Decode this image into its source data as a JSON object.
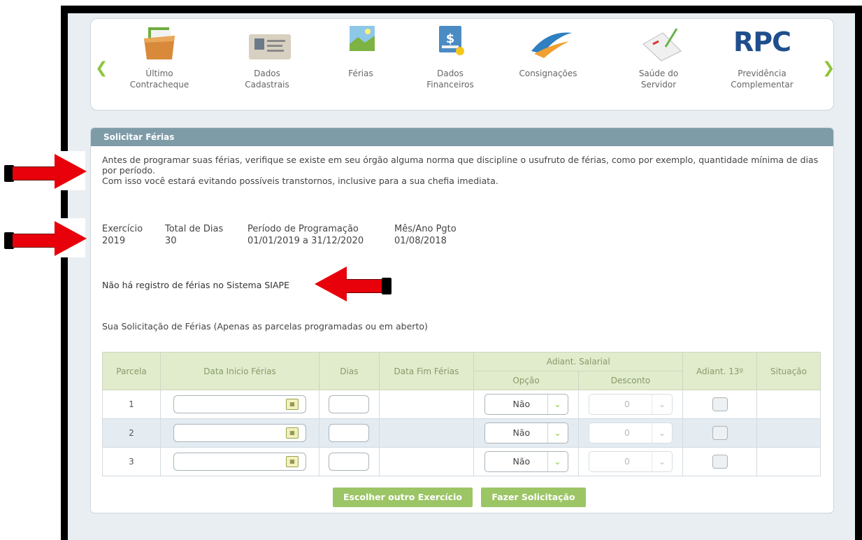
{
  "carousel": {
    "items": [
      {
        "label": "Último\nContracheque",
        "icon": "folder-icon"
      },
      {
        "label": "Dados\nCadastrais",
        "icon": "id-card-icon"
      },
      {
        "label": "Férias",
        "icon": "landscape-icon"
      },
      {
        "label": "Dados\nFinanceiros",
        "icon": "money-icon"
      },
      {
        "label": "Consignações",
        "icon": "swoosh-icon"
      },
      {
        "label": "Saúde do\nServidor",
        "icon": "clipboard-pen-icon"
      },
      {
        "label": "Previdência\nComplementar",
        "icon": "rpc-logo-icon",
        "logo_text": "RPC"
      }
    ],
    "prev_glyph": "❮",
    "next_glyph": "❯"
  },
  "panel": {
    "title": "Solicitar Férias",
    "intro_line1": "Antes de programar suas férias, verifique se existe em seu órgão alguma norma que discipline o usufruto de férias, como por exemplo, quantidade mínima de dias por período.",
    "intro_line2": "Com isso você estará evitando possíveis transtornos, inclusive para a sua chefia imediata.",
    "info": [
      {
        "label": "Exercício",
        "value": "2019"
      },
      {
        "label": "Total de Dias",
        "value": "30"
      },
      {
        "label": "Período de Programação",
        "value": "01/01/2019 a 31/12/2020"
      },
      {
        "label": "Mês/Ano Pgto",
        "value": "01/08/2018"
      }
    ],
    "no_record": "Não há registro de férias no Sistema SIAPE",
    "request_title": "Sua Solicitação de Férias (Apenas as parcelas programadas ou em aberto)"
  },
  "table": {
    "headers": {
      "parcela": "Parcela",
      "data_inicio": "Data Inicio Férias",
      "dias": "Dias",
      "data_fim": "Data Fim Férias",
      "adiant_salarial": "Adiant. Salarial",
      "opcao": "Opção",
      "desconto": "Desconto",
      "adiant_13": "Adiant. 13º",
      "situacao": "Situação"
    },
    "rows": [
      {
        "parcela": "1",
        "opcao": "Não",
        "desconto": "0"
      },
      {
        "parcela": "2",
        "opcao": "Não",
        "desconto": "0"
      },
      {
        "parcela": "3",
        "opcao": "Não",
        "desconto": "0"
      }
    ],
    "calendar_glyph": "▦",
    "chevron_glyph": "⌄"
  },
  "buttons": {
    "choose_other": "Escolher outro Exercício",
    "submit": "Fazer Solicitação"
  },
  "colors": {
    "accent_green": "#8cc63f",
    "header_bar": "#7e9ca8",
    "arrow_red": "#e8000a"
  }
}
